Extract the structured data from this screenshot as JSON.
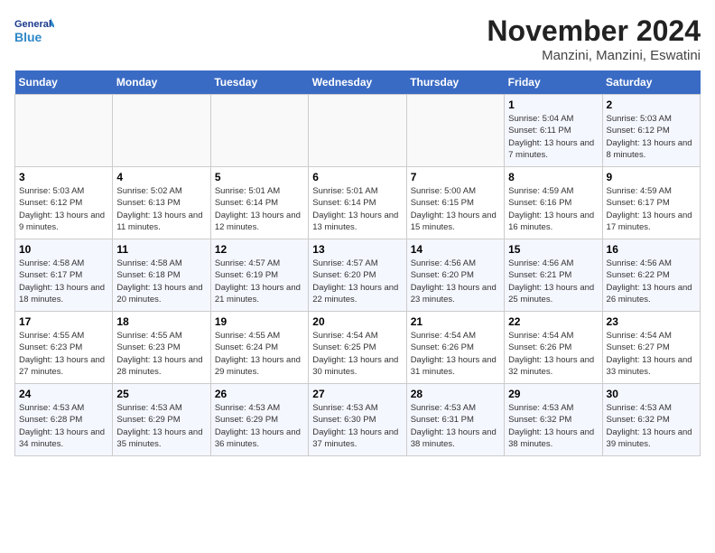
{
  "header": {
    "logo_general": "General",
    "logo_blue": "Blue",
    "month_title": "November 2024",
    "location": "Manzini, Manzini, Eswatini"
  },
  "weekdays": [
    "Sunday",
    "Monday",
    "Tuesday",
    "Wednesday",
    "Thursday",
    "Friday",
    "Saturday"
  ],
  "weeks": [
    [
      {
        "day": "",
        "info": ""
      },
      {
        "day": "",
        "info": ""
      },
      {
        "day": "",
        "info": ""
      },
      {
        "day": "",
        "info": ""
      },
      {
        "day": "",
        "info": ""
      },
      {
        "day": "1",
        "info": "Sunrise: 5:04 AM\nSunset: 6:11 PM\nDaylight: 13 hours and 7 minutes."
      },
      {
        "day": "2",
        "info": "Sunrise: 5:03 AM\nSunset: 6:12 PM\nDaylight: 13 hours and 8 minutes."
      }
    ],
    [
      {
        "day": "3",
        "info": "Sunrise: 5:03 AM\nSunset: 6:12 PM\nDaylight: 13 hours and 9 minutes."
      },
      {
        "day": "4",
        "info": "Sunrise: 5:02 AM\nSunset: 6:13 PM\nDaylight: 13 hours and 11 minutes."
      },
      {
        "day": "5",
        "info": "Sunrise: 5:01 AM\nSunset: 6:14 PM\nDaylight: 13 hours and 12 minutes."
      },
      {
        "day": "6",
        "info": "Sunrise: 5:01 AM\nSunset: 6:14 PM\nDaylight: 13 hours and 13 minutes."
      },
      {
        "day": "7",
        "info": "Sunrise: 5:00 AM\nSunset: 6:15 PM\nDaylight: 13 hours and 15 minutes."
      },
      {
        "day": "8",
        "info": "Sunrise: 4:59 AM\nSunset: 6:16 PM\nDaylight: 13 hours and 16 minutes."
      },
      {
        "day": "9",
        "info": "Sunrise: 4:59 AM\nSunset: 6:17 PM\nDaylight: 13 hours and 17 minutes."
      }
    ],
    [
      {
        "day": "10",
        "info": "Sunrise: 4:58 AM\nSunset: 6:17 PM\nDaylight: 13 hours and 18 minutes."
      },
      {
        "day": "11",
        "info": "Sunrise: 4:58 AM\nSunset: 6:18 PM\nDaylight: 13 hours and 20 minutes."
      },
      {
        "day": "12",
        "info": "Sunrise: 4:57 AM\nSunset: 6:19 PM\nDaylight: 13 hours and 21 minutes."
      },
      {
        "day": "13",
        "info": "Sunrise: 4:57 AM\nSunset: 6:20 PM\nDaylight: 13 hours and 22 minutes."
      },
      {
        "day": "14",
        "info": "Sunrise: 4:56 AM\nSunset: 6:20 PM\nDaylight: 13 hours and 23 minutes."
      },
      {
        "day": "15",
        "info": "Sunrise: 4:56 AM\nSunset: 6:21 PM\nDaylight: 13 hours and 25 minutes."
      },
      {
        "day": "16",
        "info": "Sunrise: 4:56 AM\nSunset: 6:22 PM\nDaylight: 13 hours and 26 minutes."
      }
    ],
    [
      {
        "day": "17",
        "info": "Sunrise: 4:55 AM\nSunset: 6:23 PM\nDaylight: 13 hours and 27 minutes."
      },
      {
        "day": "18",
        "info": "Sunrise: 4:55 AM\nSunset: 6:23 PM\nDaylight: 13 hours and 28 minutes."
      },
      {
        "day": "19",
        "info": "Sunrise: 4:55 AM\nSunset: 6:24 PM\nDaylight: 13 hours and 29 minutes."
      },
      {
        "day": "20",
        "info": "Sunrise: 4:54 AM\nSunset: 6:25 PM\nDaylight: 13 hours and 30 minutes."
      },
      {
        "day": "21",
        "info": "Sunrise: 4:54 AM\nSunset: 6:26 PM\nDaylight: 13 hours and 31 minutes."
      },
      {
        "day": "22",
        "info": "Sunrise: 4:54 AM\nSunset: 6:26 PM\nDaylight: 13 hours and 32 minutes."
      },
      {
        "day": "23",
        "info": "Sunrise: 4:54 AM\nSunset: 6:27 PM\nDaylight: 13 hours and 33 minutes."
      }
    ],
    [
      {
        "day": "24",
        "info": "Sunrise: 4:53 AM\nSunset: 6:28 PM\nDaylight: 13 hours and 34 minutes."
      },
      {
        "day": "25",
        "info": "Sunrise: 4:53 AM\nSunset: 6:29 PM\nDaylight: 13 hours and 35 minutes."
      },
      {
        "day": "26",
        "info": "Sunrise: 4:53 AM\nSunset: 6:29 PM\nDaylight: 13 hours and 36 minutes."
      },
      {
        "day": "27",
        "info": "Sunrise: 4:53 AM\nSunset: 6:30 PM\nDaylight: 13 hours and 37 minutes."
      },
      {
        "day": "28",
        "info": "Sunrise: 4:53 AM\nSunset: 6:31 PM\nDaylight: 13 hours and 38 minutes."
      },
      {
        "day": "29",
        "info": "Sunrise: 4:53 AM\nSunset: 6:32 PM\nDaylight: 13 hours and 38 minutes."
      },
      {
        "day": "30",
        "info": "Sunrise: 4:53 AM\nSunset: 6:32 PM\nDaylight: 13 hours and 39 minutes."
      }
    ]
  ]
}
